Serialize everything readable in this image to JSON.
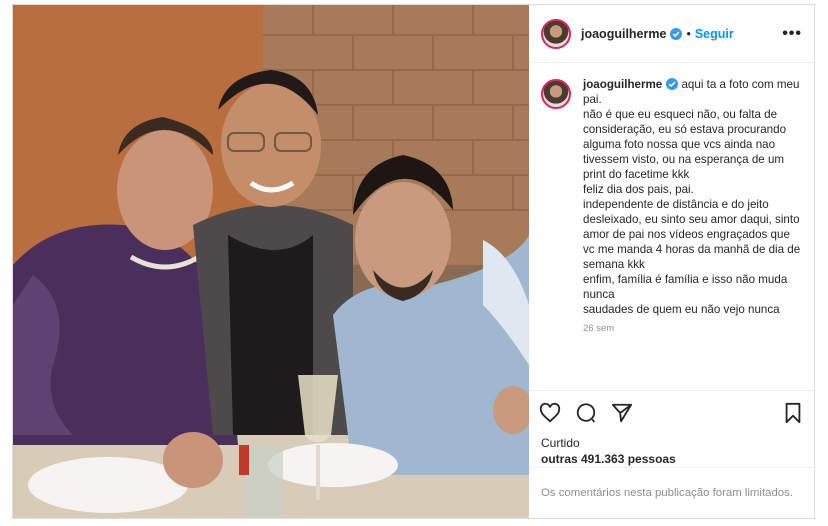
{
  "post": {
    "username": "joaoguilherme",
    "follow_label": "Seguir",
    "dot": "•",
    "more": "•••",
    "caption_lines": "aqui ta a foto com meu pai.\nnão é que eu esqueci não, ou falta de consideração, eu só estava procurando alguma foto nossa que vcs ainda nao tivessem visto, ou na esperança de um print do facetime kkk\nfeliz dia dos pais, pai.\nindependente de distância e do jeito desleixado, eu sinto seu amor daqui, sinto amor de pai nos vídeos engraçados que vc me manda 4 horas da manhã de dia de semana kkk\nenfim, família é família e isso não muda nunca\nsaudades de quem eu não vejo nunca",
    "time_ago": "26 sem",
    "liked_label": "Curtido",
    "likes_text": "outras 491.363 pessoas",
    "comments_limited": "Os comentários nesta publicação foram limitados."
  },
  "colors": {
    "accent": "#0095f6",
    "verified": "#3897f0",
    "muted": "#8e8e8e",
    "text": "#262626"
  },
  "icons": [
    "heart-icon",
    "comment-icon",
    "share-icon",
    "bookmark-icon",
    "verified-badge-icon",
    "more-options-icon"
  ]
}
